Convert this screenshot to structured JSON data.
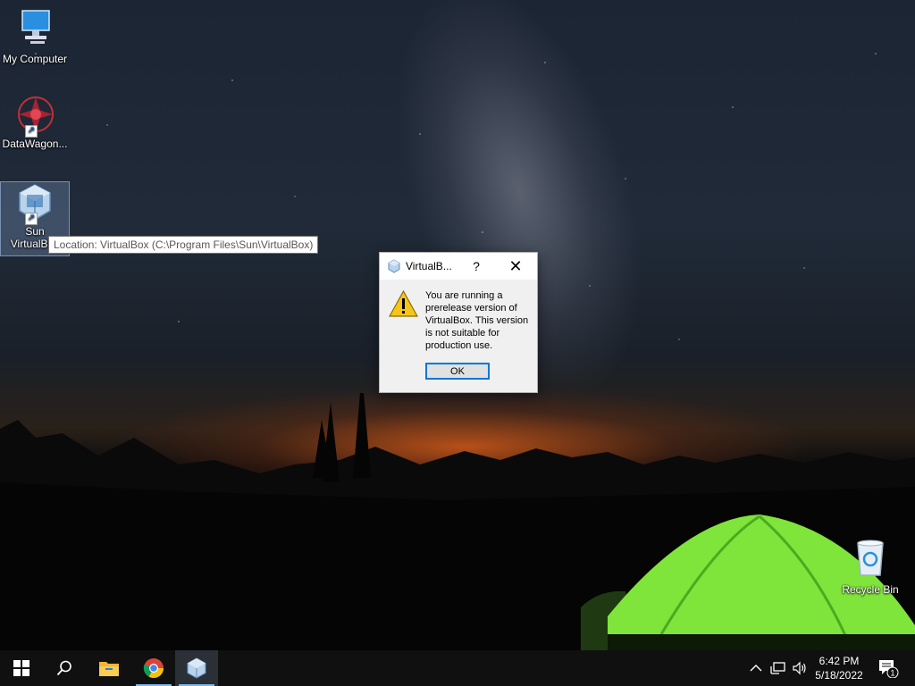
{
  "desktop": {
    "icons": [
      {
        "label": "My Computer"
      },
      {
        "label": "DataWagon..."
      },
      {
        "label": "Sun VirtualBox"
      },
      {
        "label": "Recycle Bin"
      }
    ],
    "tooltip": "Location: VirtualBox (C:\\Program Files\\Sun\\VirtualBox)"
  },
  "dialog": {
    "title": "VirtualB...",
    "help_glyph": "?",
    "close_glyph": "✕",
    "message": "You are running a prerelease version of VirtualBox. This version is not suitable for production use.",
    "ok_label": "OK"
  },
  "taskbar": {
    "start_icon": "windows-start-icon",
    "search_icon": "search-icon",
    "pinned": [
      "file-explorer-icon",
      "chrome-icon",
      "virtualbox-icon"
    ],
    "tray_icons": [
      "chevron-up-icon",
      "network-icon",
      "volume-icon"
    ],
    "time": "6:42 PM",
    "date": "5/18/2022",
    "notification_count": "1"
  },
  "colors": {
    "accent": "#0078d7",
    "taskbar": "#101010",
    "active_underline": "#76b9ed"
  }
}
